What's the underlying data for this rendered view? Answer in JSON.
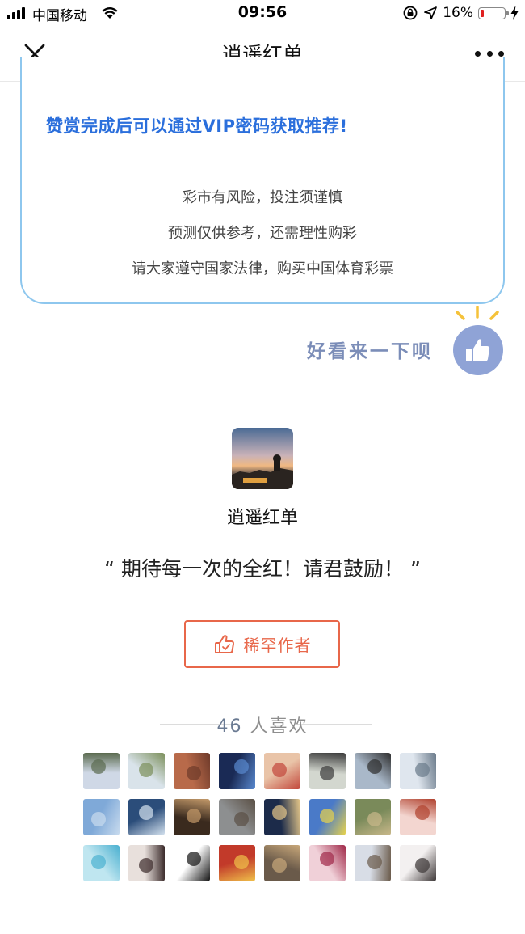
{
  "status_bar": {
    "carrier": "中国移动",
    "time": "09:56",
    "battery": "16%",
    "battery_level": 0.16,
    "icons": [
      "signal-icon",
      "wifi-icon",
      "orientation-lock-icon",
      "location-icon",
      "battery-icon",
      "charging-icon"
    ]
  },
  "navbar": {
    "title": "逍遥红单",
    "close_icon": "close-icon",
    "more_icon": "more-icon"
  },
  "notice": {
    "headline": "赞赏完成后可以通过VIP密码获取推荐!",
    "lines": [
      "彩市有风险，投注须谨慎",
      "预测仅供参考，还需理性购彩",
      "请大家遵守国家法律，购买中国体育彩票"
    ],
    "colors": {
      "headline": "#2b6fdc",
      "border": "#8ec7ee"
    }
  },
  "like_prompt": {
    "text": "好看来一下呗",
    "icon": "thumbs-up-icon",
    "color": "#8fa3d6"
  },
  "author": {
    "name": "逍遥红单",
    "avatar": "sunset-avatar",
    "quote": "“ 期待每一次的全红！请君鼓励！ ”"
  },
  "reward_button": {
    "label": "稀罕作者",
    "icon": "thumbs-up-outline-icon",
    "color": "#e8674a"
  },
  "likes": {
    "count": "46",
    "suffix": "人喜欢"
  },
  "liker_avatars": [
    {
      "name": "avatar-1",
      "colors": [
        "#cfd8e6",
        "#5a6a4e"
      ]
    },
    {
      "name": "avatar-2",
      "colors": [
        "#d9e3ea",
        "#7b8f5a"
      ]
    },
    {
      "name": "avatar-3",
      "colors": [
        "#b86a4a",
        "#6e3a2a"
      ]
    },
    {
      "name": "avatar-4",
      "colors": [
        "#1a2a55",
        "#5a8ad0"
      ]
    },
    {
      "name": "avatar-5",
      "colors": [
        "#e9c4a8",
        "#c2463a"
      ]
    },
    {
      "name": "avatar-6",
      "colors": [
        "#d3d7cf",
        "#3a3a3a"
      ]
    },
    {
      "name": "avatar-7",
      "colors": [
        "#a9b8c9",
        "#2d2d2d"
      ]
    },
    {
      "name": "avatar-8",
      "colors": [
        "#dfe6ee",
        "#6a7a8a"
      ]
    },
    {
      "name": "avatar-9",
      "colors": [
        "#7fa9d8",
        "#c9dbee"
      ]
    },
    {
      "name": "avatar-10",
      "colors": [
        "#2b4d7a",
        "#d6e3f0"
      ]
    },
    {
      "name": "avatar-11",
      "colors": [
        "#3a2a1e",
        "#c49a6a"
      ]
    },
    {
      "name": "avatar-12",
      "colors": [
        "#8d8f90",
        "#5a4f44"
      ]
    },
    {
      "name": "avatar-13",
      "colors": [
        "#1c2b4a",
        "#e8c98a"
      ]
    },
    {
      "name": "avatar-14",
      "colors": [
        "#4a7ac8",
        "#e8d34a"
      ]
    },
    {
      "name": "avatar-15",
      "colors": [
        "#7a8a5a",
        "#c9b88a"
      ]
    },
    {
      "name": "avatar-16",
      "colors": [
        "#f3d6d0",
        "#b0412e"
      ]
    },
    {
      "name": "avatar-17",
      "colors": [
        "#bfe6f0",
        "#4ab0d0"
      ]
    },
    {
      "name": "avatar-18",
      "colors": [
        "#e8e0dc",
        "#3a2a2a"
      ]
    },
    {
      "name": "avatar-19",
      "colors": [
        "#ffffff",
        "#111111"
      ]
    },
    {
      "name": "avatar-20",
      "colors": [
        "#c23a2a",
        "#f0c24a"
      ]
    },
    {
      "name": "avatar-21",
      "colors": [
        "#6a5a4a",
        "#c9a87a"
      ]
    },
    {
      "name": "avatar-22",
      "colors": [
        "#f0d0d8",
        "#a02848"
      ]
    },
    {
      "name": "avatar-23",
      "colors": [
        "#d8dde6",
        "#6a5a4a"
      ]
    },
    {
      "name": "avatar-24",
      "colors": [
        "#f3f0f0",
        "#3a3434"
      ]
    }
  ]
}
